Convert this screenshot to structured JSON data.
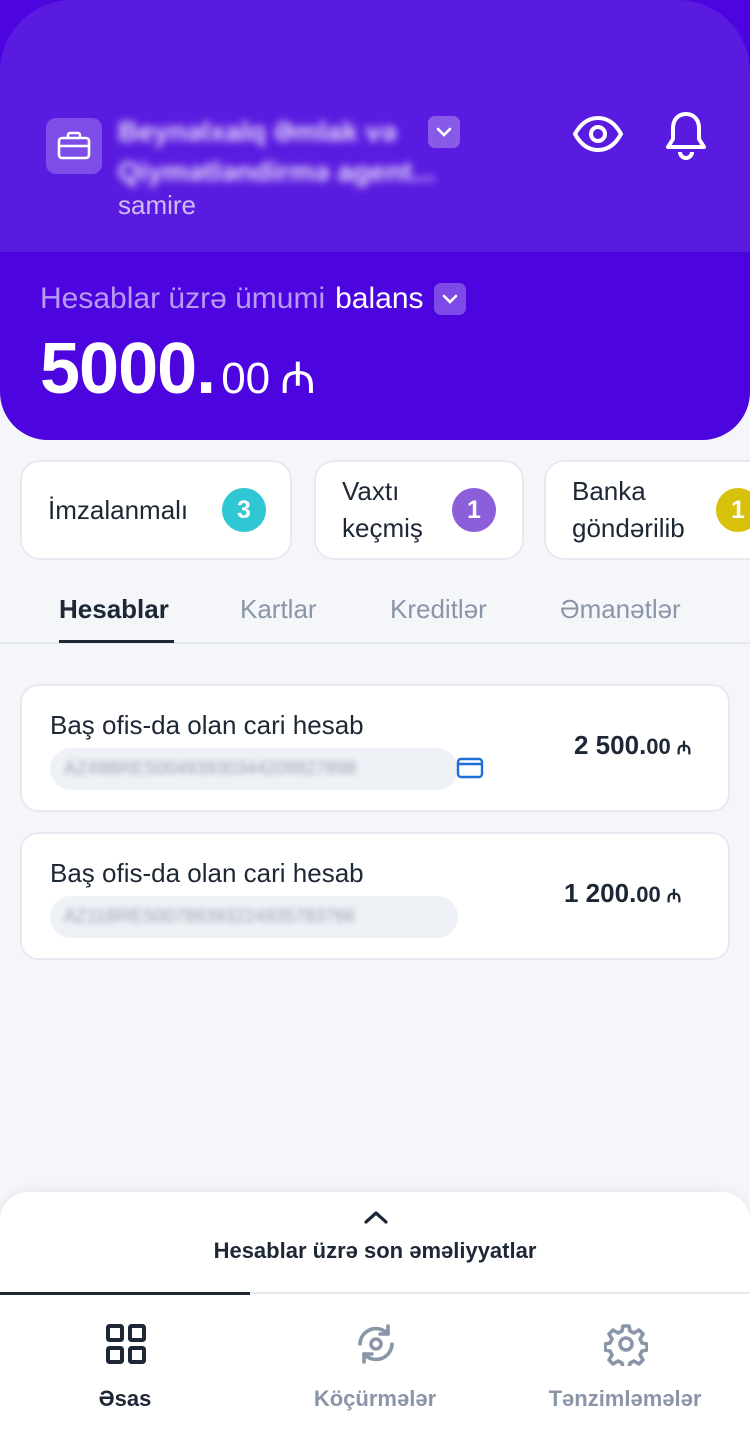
{
  "header": {
    "org_name": "Beynəlxalq Əmlak və Qiymətləndirmə agent...",
    "user": "samire",
    "balance_label": "Hesablar üzrə ümumi",
    "balance_label_strong": "balans",
    "balance_int": "5000.",
    "balance_dec": "00",
    "currency": "₼"
  },
  "chips": [
    {
      "label": "İmzalanmalı",
      "count": "3",
      "color": "#2ec7d3"
    },
    {
      "label": "Vaxtı keçmiş",
      "count": "1",
      "color": "#8b5fd9"
    },
    {
      "label": "Banka göndərilib",
      "count": "1",
      "color": "#d8c10b"
    }
  ],
  "tabs": [
    {
      "label": "Hesablar",
      "active": true
    },
    {
      "label": "Kartlar"
    },
    {
      "label": "Kreditlər"
    },
    {
      "label": "Əmanətlər"
    }
  ],
  "accounts": [
    {
      "title": "Baş ofis-da olan cari hesab",
      "iban": "AZ49BRES00493930344209827898",
      "amount_int": "2 500.",
      "amount_dec": "00",
      "currency": "₼",
      "has_card_icon": true
    },
    {
      "title": "Baş ofis-da olan cari hesab",
      "iban": "AZ11BRES00789393224935783766",
      "amount_int": "1 200.",
      "amount_dec": "00",
      "currency": "₼",
      "has_card_icon": false
    }
  ],
  "bottom_sheet": {
    "title": "Hesablar üzrə son əməliyyatlar"
  },
  "nav": [
    {
      "label": "Əsas",
      "icon": "grid-icon",
      "active": true
    },
    {
      "label": "Köçürmələr",
      "icon": "transfer-icon"
    },
    {
      "label": "Tənzimləmələr",
      "icon": "gear-icon"
    }
  ],
  "colors": {
    "header_top": "#5a1be0",
    "header_bottom": "#4c05df",
    "text_dark": "#1d2735",
    "text_muted": "#8a96a8"
  }
}
